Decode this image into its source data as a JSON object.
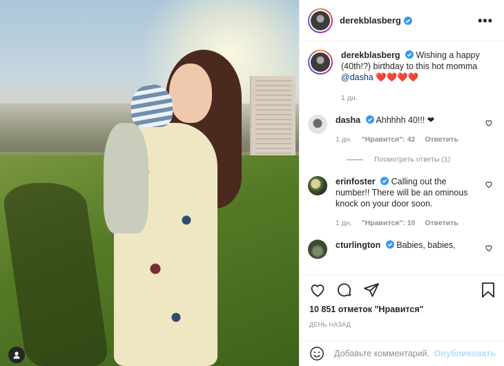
{
  "post": {
    "author": "derekblasberg",
    "caption_author": "derekblasberg",
    "caption_text": "Wishing a happy (40th!?) birthday to this hot momma",
    "caption_mention": "@dasha",
    "caption_tail": "❤️❤️❤️❤️",
    "caption_time": "1 дн.",
    "more_label": "•••"
  },
  "comments": [
    {
      "user": "dasha",
      "text": "Ahhhhh 40!!! ❤",
      "time": "1 дн.",
      "likes": "\"Нравится\": 42",
      "reply": "Ответить",
      "view_replies": "Посмотреть ответы (1)"
    },
    {
      "user": "erinfoster",
      "text": "Calling out the number!! There will be an ominous knock on your door soon.",
      "time": "1 дн.",
      "likes": "\"Нравится\": 10",
      "reply": "Ответить"
    },
    {
      "user": "cturlington",
      "text": "Babies, babies,"
    }
  ],
  "actions": {
    "likes_count": "10 851 отметок \"Нравится\"",
    "date": "ДЕНЬ НАЗАД"
  },
  "composer": {
    "placeholder": "Добавьте комментарий...",
    "publish_label": "Опубликовать"
  },
  "colors": {
    "verified": "#3897f0",
    "link": "#00376b",
    "muted": "#8e8e8e",
    "publish_disabled": "#b2dffc"
  }
}
